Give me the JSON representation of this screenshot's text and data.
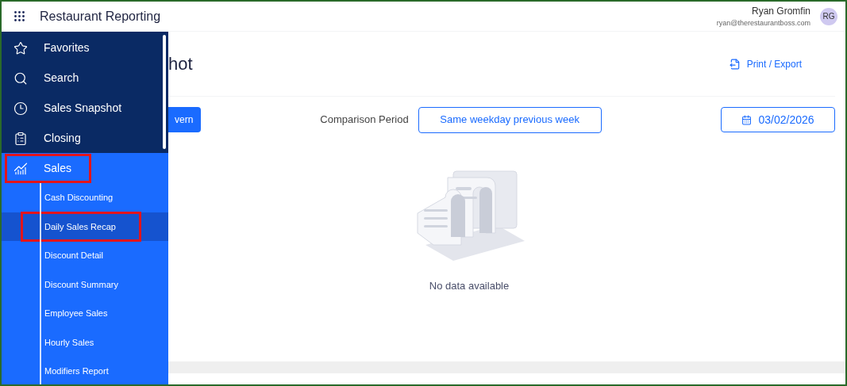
{
  "header": {
    "app_title": "Restaurant Reporting",
    "user_name": "Ryan Gromfin",
    "user_email": "ryan@therestaurantboss.com",
    "avatar_initials": "RG"
  },
  "sidebar": {
    "items": [
      {
        "kind": "star",
        "label": "Favorites",
        "selected": false,
        "highlighted": false
      },
      {
        "kind": "search",
        "label": "Search",
        "selected": false,
        "highlighted": false
      },
      {
        "kind": "pie",
        "label": "Sales Snapshot",
        "selected": false,
        "highlighted": false
      },
      {
        "kind": "clipboard",
        "label": "Closing",
        "selected": false,
        "highlighted": false
      },
      {
        "kind": "chart",
        "label": "Sales",
        "selected": true,
        "highlighted": true,
        "expanded": true,
        "children": [
          {
            "label": "Cash Discounting",
            "selected": false,
            "highlighted": false
          },
          {
            "label": "Daily Sales Recap",
            "selected": true,
            "highlighted": true
          },
          {
            "label": "Discount Detail",
            "selected": false,
            "highlighted": false
          },
          {
            "label": "Discount Summary",
            "selected": false,
            "highlighted": false
          },
          {
            "label": "Employee Sales",
            "selected": false,
            "highlighted": false
          },
          {
            "label": "Hourly Sales",
            "selected": false,
            "highlighted": false
          },
          {
            "label": "Modifiers Report",
            "selected": false,
            "highlighted": false
          }
        ]
      }
    ]
  },
  "main": {
    "title": "hot",
    "print_export": "Print / Export",
    "location_button": "vern",
    "comparison_label": "Comparison Period",
    "comparison_value": "Same weekday previous week",
    "date": "03/02/2026",
    "empty_message": "No data available"
  }
}
